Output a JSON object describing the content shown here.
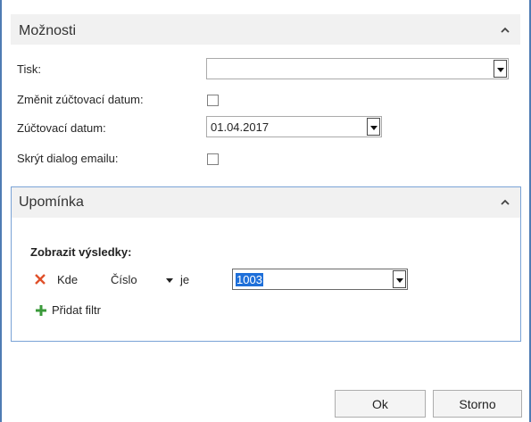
{
  "options": {
    "title": "Možnosti",
    "tisk_label": "Tisk:",
    "tisk_value": "",
    "change_date_label": "Změnit zúčtovací datum:",
    "posting_date_label": "Zúčtovací datum:",
    "posting_date_value": "01.04.2017",
    "hide_email_label": "Skrýt dialog emailu:"
  },
  "reminder": {
    "title": "Upomínka",
    "show_results_label": "Zobrazit výsledky:",
    "where_label": "Kde",
    "field_label": "Číslo",
    "operator_label": "je",
    "filter_value": "1003",
    "add_filter_label": "Přidat filtr"
  },
  "buttons": {
    "ok": "Ok",
    "cancel": "Storno"
  },
  "colors": {
    "accent_border": "#4e7bb3",
    "remove_icon": "#e0502a",
    "add_icon": "#3a9a3a"
  }
}
